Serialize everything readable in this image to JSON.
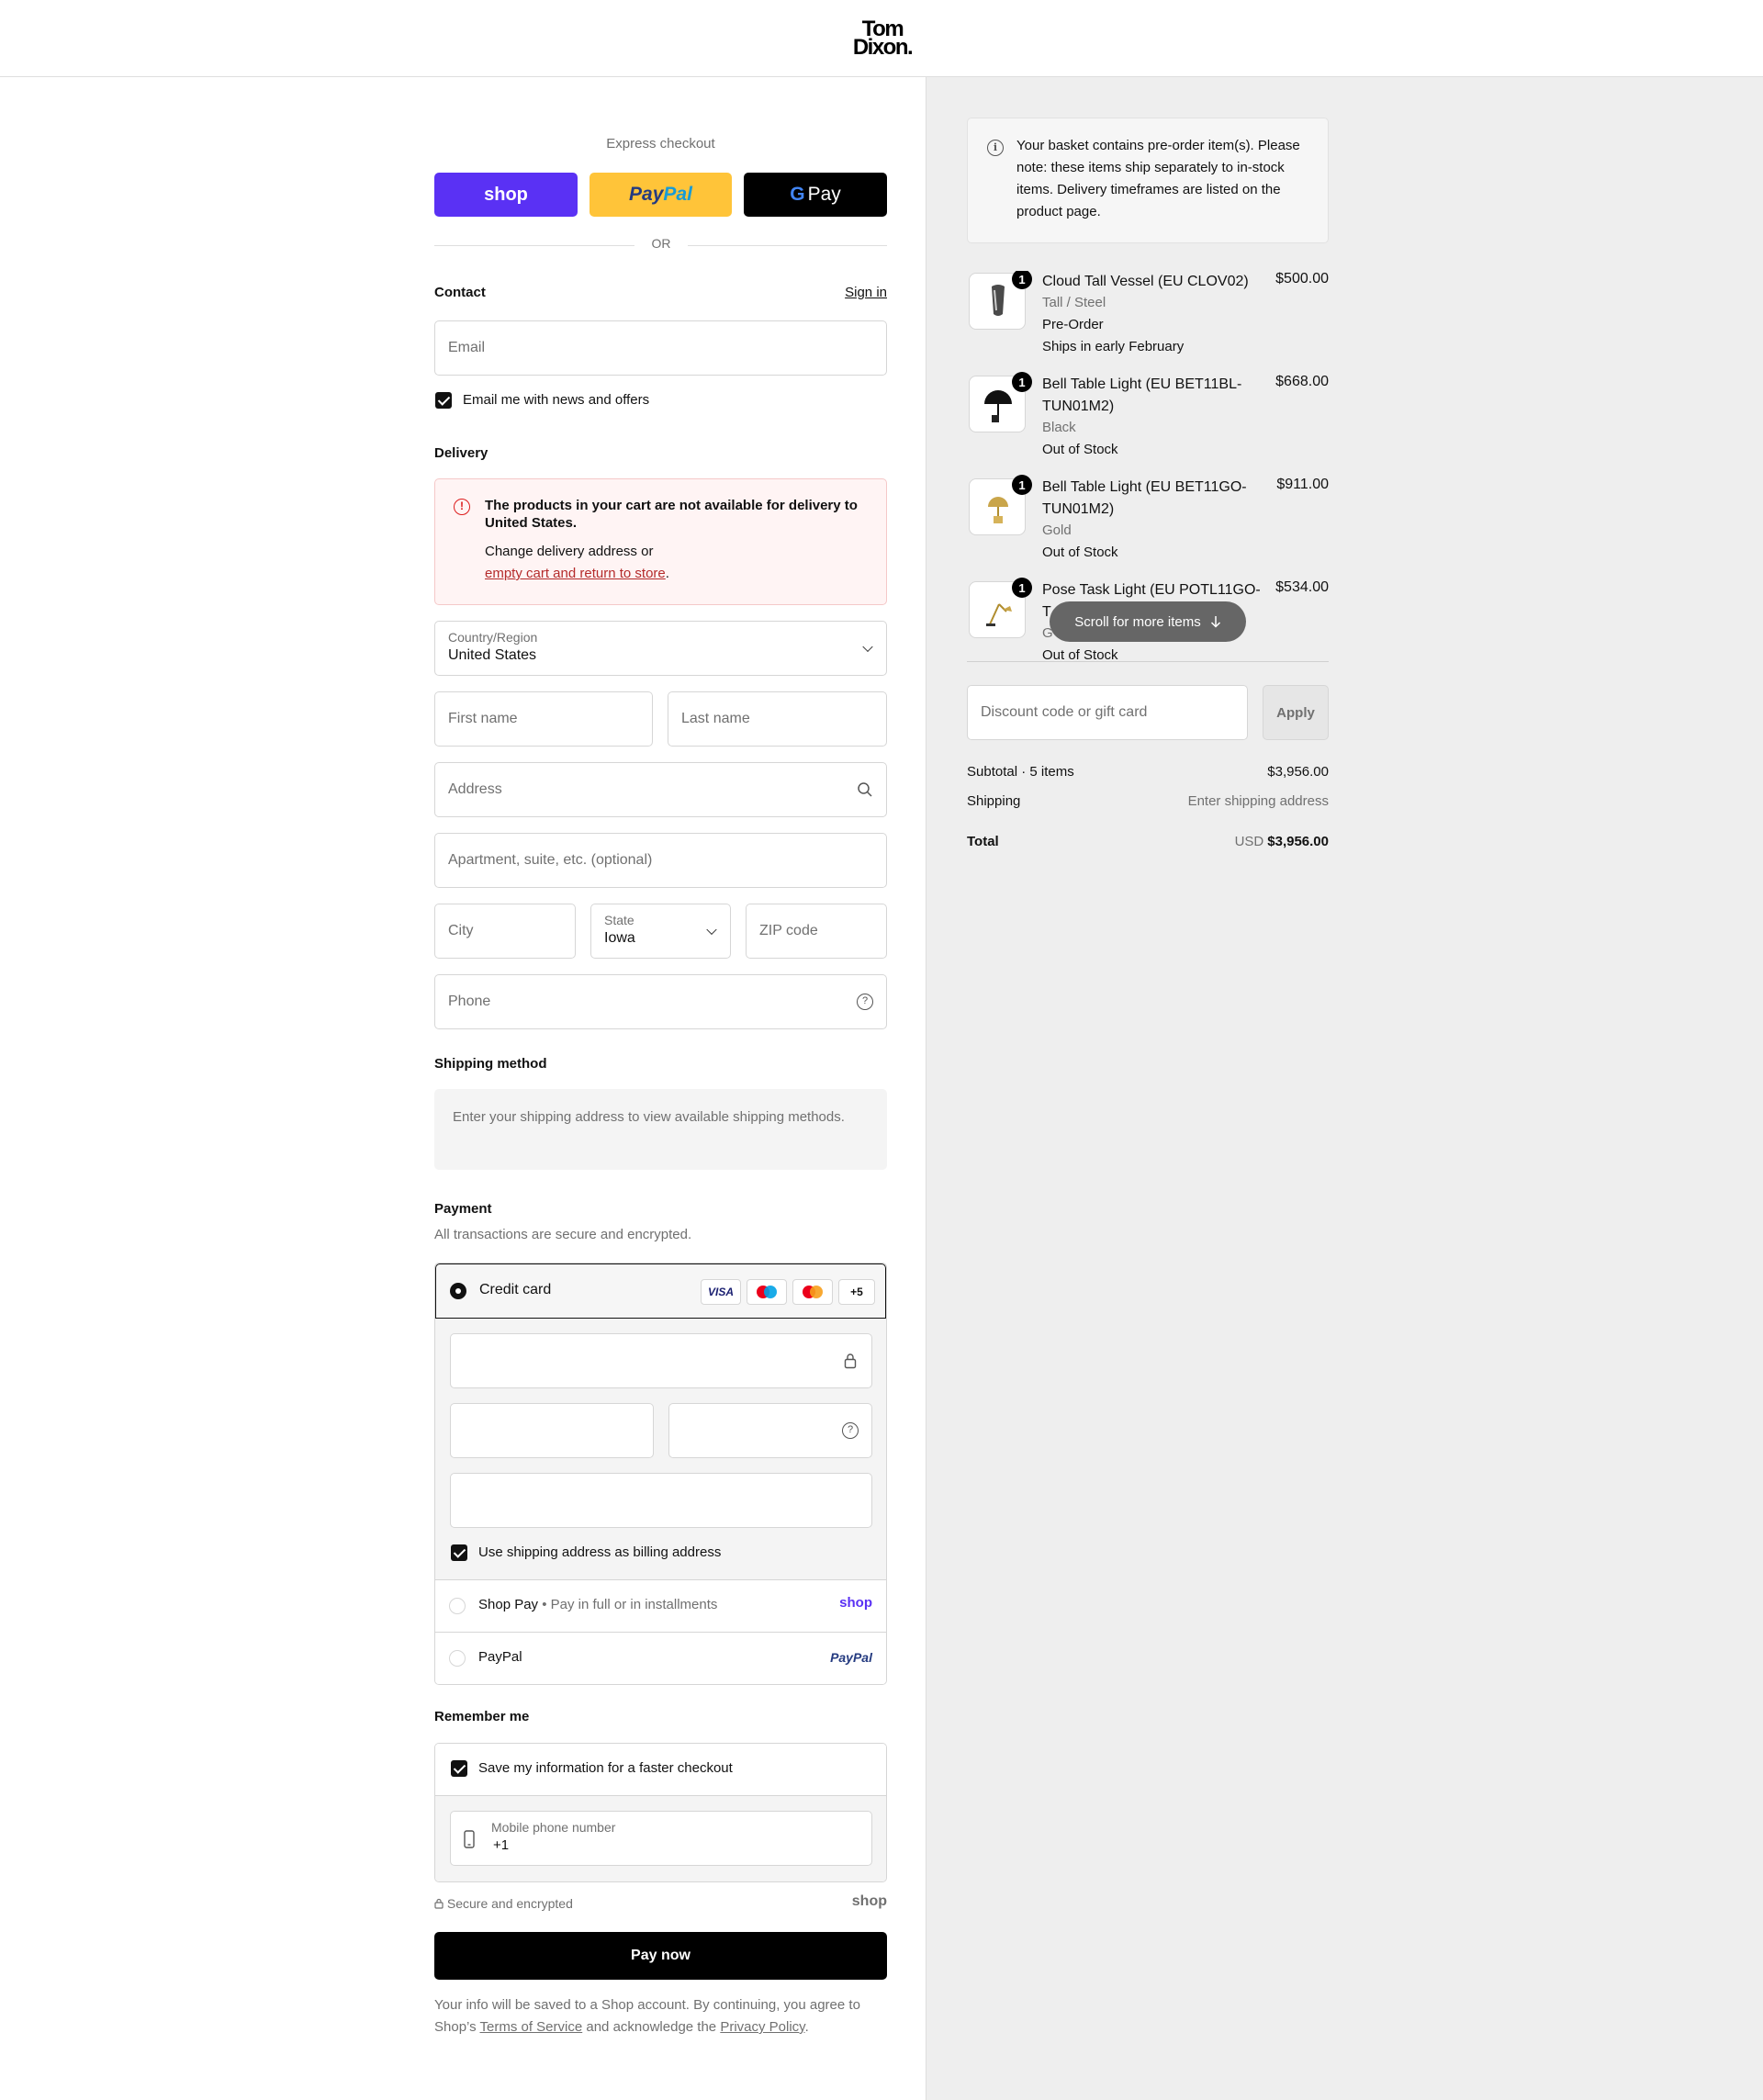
{
  "brand": {
    "logo_line1": "Tom",
    "logo_line2": "Dixon."
  },
  "express": {
    "title": "Express checkout",
    "shop_label": "shop",
    "paypal_label_pay": "Pay",
    "paypal_label_pal": "Pal",
    "gpay_g": "G",
    "gpay_label": "Pay",
    "or": "OR"
  },
  "contact": {
    "title": "Contact",
    "sign_in": "Sign in",
    "email_placeholder": "Email",
    "news_label": "Email me with news and offers"
  },
  "delivery": {
    "title": "Delivery",
    "error_title": "The products in your cart are not available for delivery to United States.",
    "error_body": "Change delivery address or",
    "error_link": "empty cart and return to store",
    "error_period": ".",
    "country_label": "Country/Region",
    "country_value": "United States",
    "first_name": "First name",
    "last_name": "Last name",
    "address": "Address",
    "apartment": "Apartment, suite, etc. (optional)",
    "city": "City",
    "state_label": "State",
    "state_value": "Iowa",
    "zip": "ZIP code",
    "phone": "Phone"
  },
  "shipping_method": {
    "title": "Shipping method",
    "message": "Enter your shipping address to view available shipping methods."
  },
  "payment": {
    "title": "Payment",
    "subtitle": "All transactions are secure and encrypted.",
    "credit_card": "Credit card",
    "cards": [
      "VISA",
      "",
      "",
      "+5"
    ],
    "billing_same": "Use shipping address as billing address",
    "shop_pay": "Shop Pay",
    "shop_pay_dot": "•",
    "shop_pay_desc": "Pay in full or in installments",
    "shop_pay_logo": "shop",
    "paypal": "PayPal",
    "paypal_logo": "PayPal"
  },
  "remember": {
    "title": "Remember me",
    "save_label": "Save my information for a faster checkout",
    "mobile_label": "Mobile phone number",
    "mobile_value": "+1",
    "secure": "Secure and encrypted",
    "shop_logo": "shop"
  },
  "pay_now": "Pay now",
  "legal": {
    "text1": "Your info will be saved to a Shop account. By continuing, you agree to Shop’s ",
    "tos": "Terms of Service",
    "text2": " and acknowledge the ",
    "privacy": "Privacy Policy",
    "text3": "."
  },
  "notice": "Your basket contains pre-order item(s). Please note: these items ship separately to in-stock items. Delivery timeframes are listed on the product page.",
  "items": [
    {
      "qty": "1",
      "title": "Cloud Tall Vessel (EU CLOV02)",
      "variant": "Tall / Steel",
      "note1": "Pre-Order",
      "note2": "Ships in early February",
      "price": "$500.00"
    },
    {
      "qty": "1",
      "title": "Bell Table Light (EU BET11BL-TUN01M2)",
      "variant": "Black",
      "note1": "Out of Stock",
      "price": "$668.00"
    },
    {
      "qty": "1",
      "title": "Bell Table Light (EU BET11GO-TUN01M2)",
      "variant": "Gold",
      "note1": "Out of Stock",
      "price": "$911.00"
    },
    {
      "qty": "1",
      "title_a": "Pose Task Light (EU POTL11GO-",
      "title_b": "T",
      "variant": "G",
      "note1": "Out of Stock",
      "price": "$534.00"
    }
  ],
  "scroll_hint": "Scroll for more items",
  "discount": {
    "placeholder": "Discount code or gift card",
    "apply": "Apply"
  },
  "summary": {
    "subtotal_label": "Subtotal · 5 items",
    "subtotal_value": "$3,956.00",
    "shipping_label": "Shipping",
    "shipping_value": "Enter shipping address",
    "total_label": "Total",
    "currency": "USD",
    "total_value": "$3,956.00"
  },
  "colors": {
    "shop_purple": "#5a31f4",
    "paypal_yellow": "#ffc439",
    "error_red": "#dd1d1d",
    "error_bg": "#fff4f4"
  }
}
